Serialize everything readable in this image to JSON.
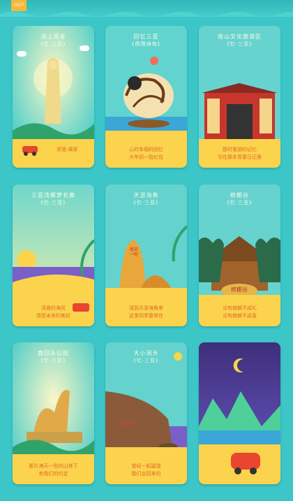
{
  "header": {
    "year": "2017"
  },
  "cards": [
    {
      "title": "海上观音",
      "subtitle": "《忆·三亚》",
      "caption1": "祈愿·阖家",
      "caption2": ""
    },
    {
      "title": "回忆三亚",
      "subtitle": "《西瑁洲岛》",
      "caption1": "心时幸福的回忆",
      "caption2": "大年初一拾红包"
    },
    {
      "title": "南山文化旅游区",
      "subtitle": "《忆·三亚》",
      "caption1": "那时看游的记忆",
      "caption2": "写在那本青春日记里"
    },
    {
      "title": "三亚湾椰梦长廊",
      "subtitle": "《忆·三亚》",
      "caption1": "清晨的海风",
      "caption2": "感受未来的美好"
    },
    {
      "title": "天涯海角",
      "subtitle": "《忆·三亚》",
      "caption1": "请到天涯海角来",
      "caption2": "这里四季春常在"
    },
    {
      "title": "槟榔谷",
      "subtitle": "《忆·三亚》",
      "caption1": "没有槟榔不成礼",
      "caption2": "没有槟榔不成喜"
    },
    {
      "title": "鹿回头公园",
      "subtitle": "《忆·三亚》",
      "caption1": "那片海天一色的山林下",
      "caption2": "有我们的约定"
    },
    {
      "title": "大小洞天",
      "subtitle": "《忆·三亚》",
      "caption1": "曾经一起遨游",
      "caption2": "我们会回来的"
    },
    {
      "title": "",
      "subtitle": "",
      "caption1": "",
      "caption2": ""
    }
  ],
  "signs": {
    "tianya": "南天一柱",
    "binglang": "槟榔谷",
    "dongtian": "天涯人"
  },
  "colors": {
    "background": "#3cc6c8",
    "sand": "#f8c73a",
    "caption": "#e06b2a",
    "night": "#4a3c8a"
  }
}
